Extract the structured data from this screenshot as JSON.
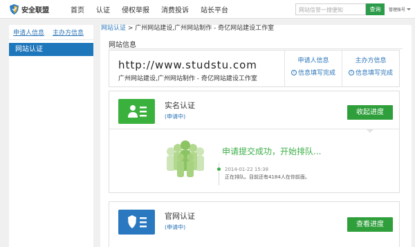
{
  "header": {
    "logo_text": "安全联盟",
    "nav": [
      "首页",
      "认证",
      "侵权举报",
      "消费投诉",
      "站长平台"
    ],
    "search_placeholder": "网站信誉一搜便知",
    "search_button": "查询",
    "user_menu": "管理账号"
  },
  "sidebar": {
    "tabs": [
      "申请人信息",
      "主办方信息"
    ],
    "active_item": "网站认证"
  },
  "breadcrumb": {
    "link": "网站认证",
    "separator": " > ",
    "current": "广州网站建设,广州网站制作 - 奇亿网站建设工作室"
  },
  "site_info": {
    "section_title": "网站信息",
    "url": "http://www.studstu.com",
    "name": "广州网站建设,广州网站制作 - 奇亿网站建设工作室",
    "applicant": {
      "label": "申请人信息",
      "status": "信息填写完成"
    },
    "sponsor": {
      "label": "主办方信息",
      "status": "信息填写完成"
    }
  },
  "realname": {
    "title": "实名认证",
    "status": "(申请中)",
    "button": "收起进度",
    "queue_title": "申请提交成功，开始排队...",
    "date": "2014-01-22 15:38",
    "message": "正在排队。目前还有4184人在你前面。"
  },
  "official": {
    "title": "官网认证",
    "status": "(申请中)",
    "button": "查看进度"
  },
  "colors": {
    "green": "#2e9f3a",
    "blue": "#1e76bb",
    "link": "#2a74b8"
  }
}
